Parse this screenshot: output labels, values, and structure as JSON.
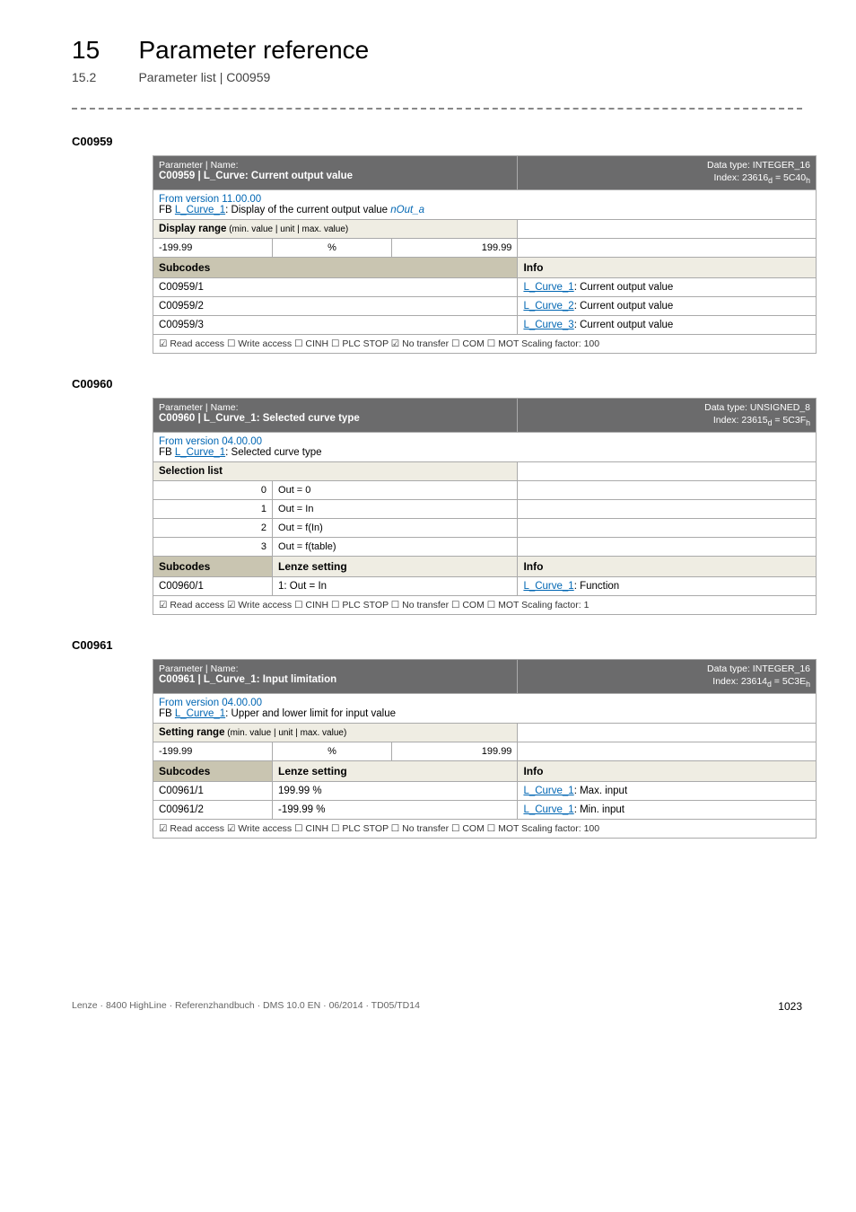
{
  "header": {
    "chapter_number": "15",
    "chapter_title": "Parameter reference",
    "section_number": "15.2",
    "section_title": "Parameter list | C00959"
  },
  "tables": [
    {
      "anchor": "C00959",
      "param_name_label": "Parameter | Name:",
      "param_title": "C00959 | L_Curve: Current output value",
      "dtype_line1": "Data type: INTEGER_16",
      "dtype_line2": "Index: 23616",
      "dtype_d": "d",
      "dtype_eq": " = 5C40",
      "dtype_h": "h",
      "desc_prefix": "From version 11.00.00",
      "desc_line2_pre": "FB ",
      "desc_link": "L_Curve_1",
      "desc_line2_post": ": Display of the current output value ",
      "desc_italic": "nOut_a",
      "range_label": "Display range",
      "range_sub": " (min. value | unit | max. value)",
      "range_min": "-199.99",
      "range_unit": "%",
      "range_max": "199.99",
      "subcodes_label": "Subcodes",
      "info_label": "Info",
      "rows": [
        {
          "code": "C00959/1",
          "link": "L_Curve_1",
          "text": ": Current output value"
        },
        {
          "code": "C00959/2",
          "link": "L_Curve_2",
          "text": ": Current output value"
        },
        {
          "code": "C00959/3",
          "link": "L_Curve_3",
          "text": ": Current output value"
        }
      ],
      "footer": "☑ Read access   ☐ Write access   ☐ CINH   ☐ PLC STOP   ☑ No transfer   ☐ COM   ☐ MOT    Scaling factor: 100"
    },
    {
      "anchor": "C00960",
      "param_name_label": "Parameter | Name:",
      "param_title": "C00960 | L_Curve_1: Selected curve type",
      "dtype_line1": "Data type: UNSIGNED_8",
      "dtype_line2": "Index: 23615",
      "dtype_d": "d",
      "dtype_eq": " = 5C3F",
      "dtype_h": "h",
      "desc_prefix": "From version 04.00.00",
      "desc_line2_pre": "FB ",
      "desc_link": "L_Curve_1",
      "desc_line2_post": ": Selected curve type",
      "sel_label": "Selection list",
      "sel_rows": [
        {
          "n": "0",
          "v": "Out = 0"
        },
        {
          "n": "1",
          "v": "Out = In"
        },
        {
          "n": "2",
          "v": "Out = f(In)"
        },
        {
          "n": "3",
          "v": "Out = f(table)"
        }
      ],
      "subcodes_label": "Subcodes",
      "lenze_label": "Lenze setting",
      "info_label": "Info",
      "rows": [
        {
          "code": "C00960/1",
          "setting": "1: Out = In",
          "link": "L_Curve_1",
          "text": ": Function"
        }
      ],
      "footer": "☑ Read access   ☑ Write access   ☐ CINH   ☐ PLC STOP   ☐ No transfer   ☐ COM   ☐ MOT    Scaling factor: 1"
    },
    {
      "anchor": "C00961",
      "param_name_label": "Parameter | Name:",
      "param_title": "C00961 | L_Curve_1: Input limitation",
      "dtype_line1": "Data type: INTEGER_16",
      "dtype_line2": "Index: 23614",
      "dtype_d": "d",
      "dtype_eq": " = 5C3E",
      "dtype_h": "h",
      "desc_prefix": "From version 04.00.00",
      "desc_line2_pre": "FB ",
      "desc_link": "L_Curve_1",
      "desc_line2_post": ": Upper and lower limit for input value",
      "range_label": "Setting range",
      "range_sub": " (min. value | unit | max. value)",
      "range_min": "-199.99",
      "range_unit": "%",
      "range_max": "199.99",
      "subcodes_label": "Subcodes",
      "lenze_label": "Lenze setting",
      "info_label": "Info",
      "rows": [
        {
          "code": "C00961/1",
          "setting": "199.99 %",
          "link": "L_Curve_1",
          "text": ": Max. input"
        },
        {
          "code": "C00961/2",
          "setting": "-199.99 %",
          "link": "L_Curve_1",
          "text": ": Min. input"
        }
      ],
      "footer": "☑ Read access   ☑ Write access   ☐ CINH   ☐ PLC STOP   ☐ No transfer   ☐ COM   ☐ MOT    Scaling factor: 100"
    }
  ],
  "footer": {
    "left": "Lenze · 8400 HighLine · Referenzhandbuch · DMS 10.0 EN · 06/2014 · TD05/TD14",
    "right": "1023"
  }
}
